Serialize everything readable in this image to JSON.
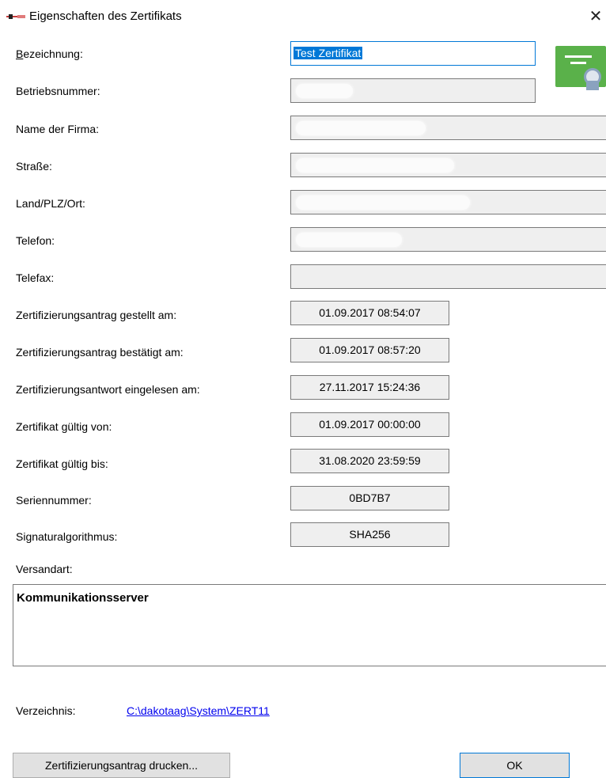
{
  "window": {
    "title": "Eigenschaften des Zertifikats",
    "close_symbol": "✕"
  },
  "fields": {
    "bezeichnung": {
      "label": "Bezeichnung:",
      "mnemonic": "B",
      "label_rest": "ezeichnung:",
      "value": "Test Zertifikat"
    },
    "betriebsnummer": {
      "label": "Betriebsnummer:"
    },
    "firma": {
      "label": "Name der Firma:"
    },
    "strasse": {
      "label": "Straße:"
    },
    "ort": {
      "label": "Land/PLZ/Ort:"
    },
    "telefon": {
      "label": "Telefon:"
    },
    "telefax": {
      "label": "Telefax:"
    },
    "antrag_gestellt": {
      "label": "Zertifizierungsantrag gestellt am:",
      "value": "01.09.2017 08:54:07"
    },
    "antrag_bestaetigt": {
      "label": "Zertifizierungsantrag bestätigt am:",
      "value": "01.09.2017 08:57:20"
    },
    "antwort_eingelesen": {
      "label": "Zertifizierungsantwort eingelesen am:",
      "value": "27.11.2017 15:24:36"
    },
    "gueltig_von": {
      "label": "Zertifikat gültig von:",
      "value": "01.09.2017 00:00:00"
    },
    "gueltig_bis": {
      "label": "Zertifikat gültig bis:",
      "value": "31.08.2020 23:59:59"
    },
    "seriennummer": {
      "label": "Seriennummer:",
      "value": "0BD7B7"
    },
    "signatur": {
      "label": "Signaturalgorithmus:",
      "value": "SHA256"
    }
  },
  "versandart": {
    "label": "Versandart:",
    "value": "Kommunikationsserver"
  },
  "verzeichnis": {
    "label": "Verzeichnis:",
    "path": "C:\\dakotaag\\System\\ZERT11"
  },
  "buttons": {
    "print": "Zertifizierungsantrag drucken...",
    "ok": "OK"
  },
  "icons": {
    "app": "app-logo-icon",
    "certificate": "certificate-icon",
    "close": "close-icon"
  }
}
